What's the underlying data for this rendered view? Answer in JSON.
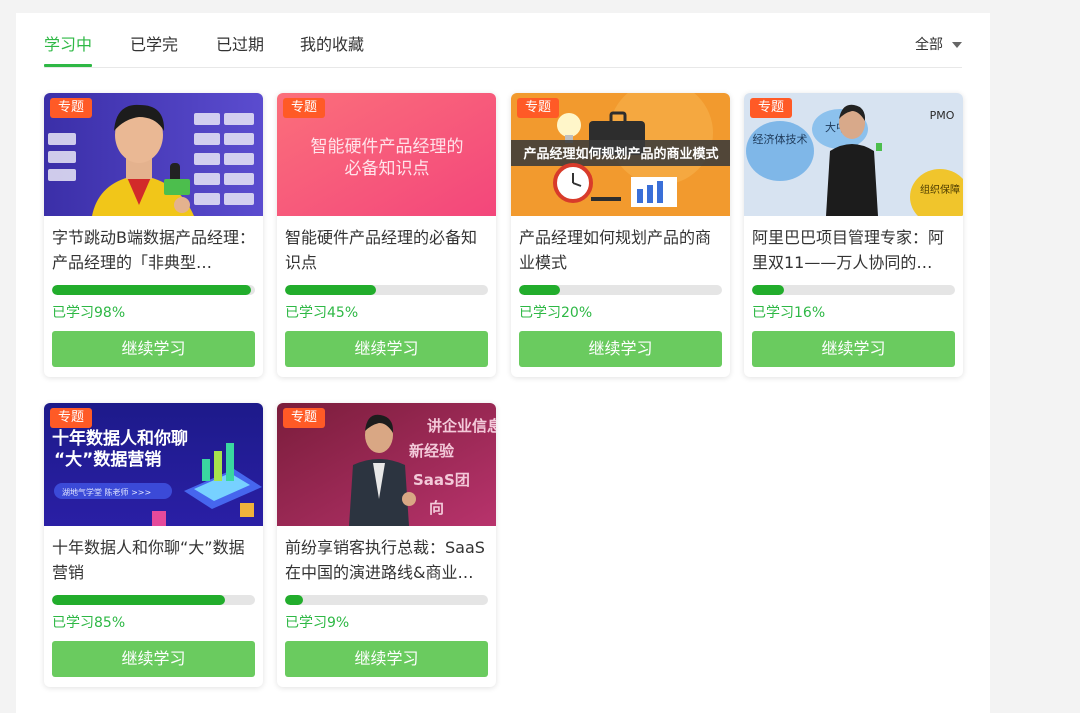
{
  "tabs": [
    {
      "label": "学习中",
      "active": true
    },
    {
      "label": "已学完",
      "active": false
    },
    {
      "label": "已过期",
      "active": false
    },
    {
      "label": "我的收藏",
      "active": false
    }
  ],
  "filter": {
    "label": "全部",
    "icon": "caret-down-icon"
  },
  "colors": {
    "accent": "#2eb845",
    "button": "#6acb5f",
    "tag": "#ff5a26",
    "progress": "#22ad2c"
  },
  "courses": [
    {
      "tag": "专题",
      "title": "字节跳动B端数据产品经理：产品经理的「非典型…",
      "progress": 0.98,
      "progress_label": "已学习98%",
      "button": "继续学习",
      "image": {
        "subject": "young-man-speaking-photo"
      }
    },
    {
      "tag": "专题",
      "title": "智能硬件产品经理的必备知识点",
      "progress": 0.45,
      "progress_label": "已学习45%",
      "button": "继续学习",
      "image": {
        "line1": "智能硬件产品经理的",
        "line2": "必备知识点"
      }
    },
    {
      "tag": "专题",
      "title": "产品经理如何规划产品的商业模式",
      "progress": 0.2,
      "progress_label": "已学习20%",
      "button": "继续学习",
      "image": {
        "text": "产品经理如何规划产品的商业模式"
      }
    },
    {
      "tag": "专题",
      "title": "阿里巴巴项目管理专家：阿里双11——万人协同的…",
      "progress": 0.16,
      "progress_label": "已学习16%",
      "button": "继续学习",
      "image": {
        "bubble1": "经济体技术",
        "bubble2": "大中",
        "corner": "PMO",
        "bubble3": "组织保障"
      }
    },
    {
      "tag": "专题",
      "title": "十年数据人和你聊“大”数据营销",
      "progress": 0.85,
      "progress_label": "已学习85%",
      "button": "继续学习",
      "image": {
        "line1": "十年数据人和你聊",
        "line2": "“大”数据营销",
        "chip": "湖地气学堂 陈老师 >>>"
      }
    },
    {
      "tag": "专题",
      "title": "前纷享销客执行总裁：SaaS在中国的演进路线&商业…",
      "progress": 0.09,
      "progress_label": "已学习9%",
      "button": "继续学习",
      "image": {
        "sign1": "讲企业信息",
        "sign2": "新经验",
        "sign3": "SaaS团",
        "sign4": "向"
      }
    }
  ]
}
